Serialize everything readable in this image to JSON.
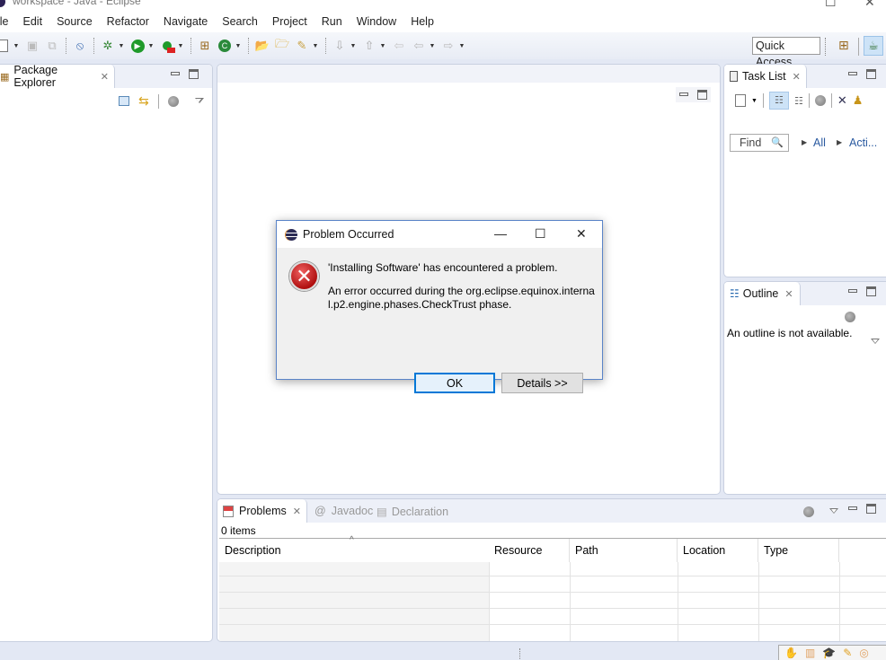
{
  "window": {
    "title": "workspace - Java - Eclipse",
    "minimize": "—",
    "maximize": "☐",
    "close": "✕"
  },
  "menu": [
    "ile",
    "Edit",
    "Source",
    "Refactor",
    "Navigate",
    "Search",
    "Project",
    "Run",
    "Window",
    "Help"
  ],
  "toolbar": {
    "quick_access": "Quick Access"
  },
  "package_explorer": {
    "tab_label": "Package Explorer"
  },
  "task_list": {
    "tab_label": "Task List",
    "find_placeholder": "Find",
    "filter_all": "All",
    "filter_active": "Acti..."
  },
  "outline": {
    "tab_label": "Outline",
    "message": "An outline is not available."
  },
  "bottom": {
    "tabs": [
      {
        "label": "Problems",
        "active": true
      },
      {
        "label": "Javadoc",
        "active": false
      },
      {
        "label": "Declaration",
        "active": false
      }
    ],
    "item_count": "0 items",
    "columns": [
      "Description",
      "Resource",
      "Path",
      "Location",
      "Type"
    ]
  },
  "dialog": {
    "title": "Problem Occurred",
    "heading": "'Installing Software' has encountered a problem.",
    "message": "An error occurred during the org.eclipse.equinox.internal.p2.engine.phases.CheckTrust phase.",
    "ok_label": "OK",
    "details_label": "Details >>"
  },
  "colors": {
    "accent": "#0078d7",
    "error": "#c81a1a",
    "panel_bg": "#e3e8f4"
  }
}
